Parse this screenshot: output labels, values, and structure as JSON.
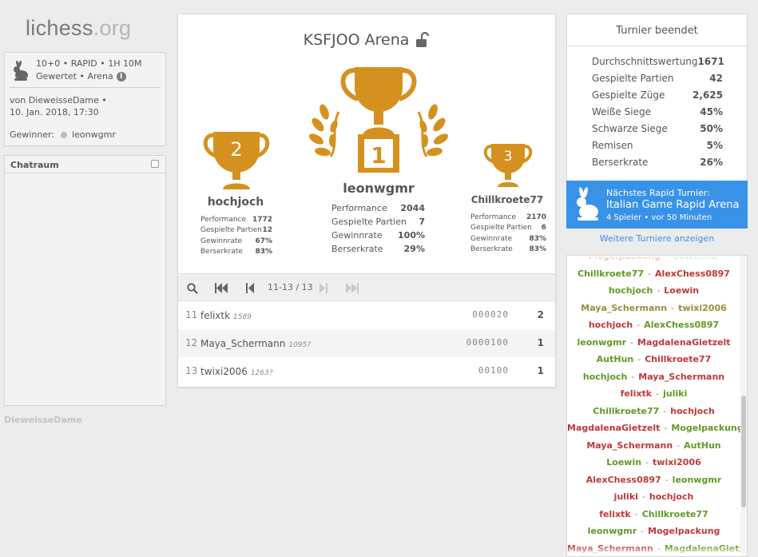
{
  "logo": {
    "main": "lichess",
    "tld": ".org"
  },
  "info": {
    "meta_line1": "10+0 • RAPID • 1H 10M",
    "meta_line2": "Gewertet • Arena",
    "by_line1": "von DieweisseDame •",
    "by_line2": "10. Jan. 2018, 17:30",
    "winner_label": "Gewinner:",
    "winner_name": "leonwgmr"
  },
  "chat": {
    "title": "Chatraum"
  },
  "bottom_user": "DieweisseDame",
  "tournament": {
    "title": "KSFJOO Arena"
  },
  "podium": [
    {
      "rank": "2",
      "name": "hochjoch",
      "stats": [
        [
          "Performance",
          "1772"
        ],
        [
          "Gespielte Partien",
          "12"
        ],
        [
          "Gewinnrate",
          "67%"
        ],
        [
          "Berserkrate",
          "83%"
        ]
      ]
    },
    {
      "rank": "1",
      "name": "leonwgmr",
      "stats": [
        [
          "Performance",
          "2044"
        ],
        [
          "Gespielte Partien",
          "7"
        ],
        [
          "Gewinnrate",
          "100%"
        ],
        [
          "Berserkrate",
          "29%"
        ]
      ]
    },
    {
      "rank": "3",
      "name": "Chillkroete77",
      "stats": [
        [
          "Performance",
          "2170"
        ],
        [
          "Gespielte Partien",
          "6"
        ],
        [
          "Gewinnrate",
          "83%"
        ],
        [
          "Berserkrate",
          "83%"
        ]
      ]
    }
  ],
  "pager": {
    "range": "11-13 / 13"
  },
  "standings": [
    {
      "rank": "11",
      "name": "felixtk",
      "rating": "1589",
      "score": "000020",
      "total": "2"
    },
    {
      "rank": "12",
      "name": "Maya_Schermann",
      "rating": "1095?",
      "score": "0000100",
      "total": "1"
    },
    {
      "rank": "13",
      "name": "twixi2006",
      "rating": "1263?",
      "score": "00100",
      "total": "1"
    }
  ],
  "summary": {
    "title": "Turnier beendet",
    "rows": [
      [
        "Durchschnittswertung",
        "1671"
      ],
      [
        "Gespielte Partien",
        "42"
      ],
      [
        "Gespielte Züge",
        "2,625"
      ],
      [
        "Weiße Siege",
        "45%"
      ],
      [
        "Schwarze Siege",
        "50%"
      ],
      [
        "Remisen",
        "5%"
      ],
      [
        "Berserkrate",
        "26%"
      ]
    ]
  },
  "next_tournament": {
    "label": "Nächstes Rapid Turnier:",
    "name": "Italian Game Rapid Arena",
    "details": "4 Spieler • vor 50 Minuten"
  },
  "more_link": "Weitere Turniere anzeigen",
  "pairings": [
    {
      "w": "Mogelpackung",
      "ws": "l",
      "b": "Gewinner",
      "bs": "w"
    },
    {
      "w": "Chillkroete77",
      "ws": "w",
      "b": "AlexChess0897",
      "bs": "l"
    },
    {
      "w": "hochjoch",
      "ws": "w",
      "b": "Loewin",
      "bs": "l"
    },
    {
      "w": "Maya_Schermann",
      "ws": "d",
      "b": "twixi2006",
      "bs": "d"
    },
    {
      "w": "hochjoch",
      "ws": "l",
      "b": "AlexChess0897",
      "bs": "w"
    },
    {
      "w": "leonwgmr",
      "ws": "w",
      "b": "MagdalenaGietzelt",
      "bs": "l"
    },
    {
      "w": "AutHun",
      "ws": "w",
      "b": "Chillkroete77",
      "bs": "l"
    },
    {
      "w": "hochjoch",
      "ws": "w",
      "b": "Maya_Schermann",
      "bs": "l"
    },
    {
      "w": "felixtk",
      "ws": "l",
      "b": "juliki",
      "bs": "w"
    },
    {
      "w": "Chillkroete77",
      "ws": "w",
      "b": "hochjoch",
      "bs": "l"
    },
    {
      "w": "MagdalenaGietzelt",
      "ws": "l",
      "b": "Mogelpackung",
      "bs": "w"
    },
    {
      "w": "Maya_Schermann",
      "ws": "l",
      "b": "AutHun",
      "bs": "w"
    },
    {
      "w": "Loewin",
      "ws": "w",
      "b": "twixi2006",
      "bs": "l"
    },
    {
      "w": "AlexChess0897",
      "ws": "l",
      "b": "leonwgmr",
      "bs": "w"
    },
    {
      "w": "juliki",
      "ws": "l",
      "b": "hochjoch",
      "bs": "l"
    },
    {
      "w": "felixtk",
      "ws": "l",
      "b": "Chillkroete77",
      "bs": "w"
    },
    {
      "w": "leonwgmr",
      "ws": "w",
      "b": "Mogelpackung",
      "bs": "l"
    },
    {
      "w": "Maya_Schermann",
      "ws": "l",
      "b": "MagdalenaGietzelt",
      "bs": "w"
    }
  ],
  "colors": {
    "accent": "#3893e8",
    "trophy": "#d59120",
    "win": "#629924",
    "loss": "#bf3838",
    "draw": "#9b8d3a"
  }
}
